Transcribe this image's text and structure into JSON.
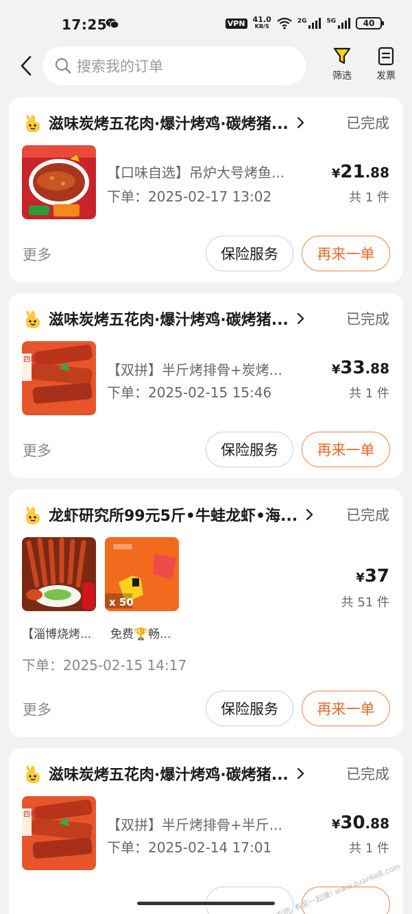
{
  "status_bar": {
    "time": "17:25",
    "vpn": "VPN",
    "net_speed_value": "41.0",
    "net_speed_unit": "KB/S",
    "sig1_label": "2G",
    "sig2_label": "5G",
    "battery": "40"
  },
  "top_bar": {
    "search_placeholder": "搜索我的订单",
    "filter_label": "筛选",
    "invoice_label": "发票"
  },
  "colors": {
    "accent": "#e8692a",
    "logo_yellow": "#ffc93c",
    "filter_icon_yellow": "#ffd21f"
  },
  "orders": [
    {
      "shop": "滋味炭烤五花肉·爆汁烤鸡·碳烤猪...",
      "status": "已完成",
      "item_title": "【口味自选】吊炉大号烤鱼...",
      "order_time": "下单：2025-02-17 13:02",
      "price_cur": "¥",
      "price_int": "21",
      "price_dec": ".88",
      "count": "共 1 件",
      "more": "更多",
      "btn_insurance": "保险服务",
      "btn_reorder": "再来一单"
    },
    {
      "shop": "滋味炭烤五花肉·爆汁烤鸡·碳烤猪...",
      "status": "已完成",
      "item_title": "【双拼】半斤烤排骨+炭烤...",
      "order_time": "下单：2025-02-15 15:46",
      "price_cur": "¥",
      "price_int": "33",
      "price_dec": ".88",
      "count": "共 1 件",
      "thumb_tag": "四季香",
      "more": "更多",
      "btn_insurance": "保险服务",
      "btn_reorder": "再来一单"
    },
    {
      "shop": "龙虾研究所99元5斤•牛蛙龙虾•海...",
      "status": "已完成",
      "item1_caption": "【淄博烧烤...",
      "item2_caption": "免费🏆畅...",
      "item2_qty": "x 50",
      "order_time": "下单：2025-02-15 14:17",
      "price_cur": "¥",
      "price_int": "37",
      "price_dec": "",
      "count": "共 51 件",
      "more": "更多",
      "btn_insurance": "保险服务",
      "btn_reorder": "再来一单"
    },
    {
      "shop": "滋味炭烤五花肉·爆汁烤鸡·碳烤猪...",
      "status": "已完成",
      "item_title": "【双拼】半斤烤排骨+半斤...",
      "order_time": "下单：2025-02-14 17:01",
      "price_cur": "¥",
      "price_int": "30",
      "price_dec": ".88",
      "count": "共 1 件",
      "thumb_tag": "四季香"
    }
  ],
  "watermark": "羊毛吧, 有奖一起赚! www.zuanke8.com"
}
